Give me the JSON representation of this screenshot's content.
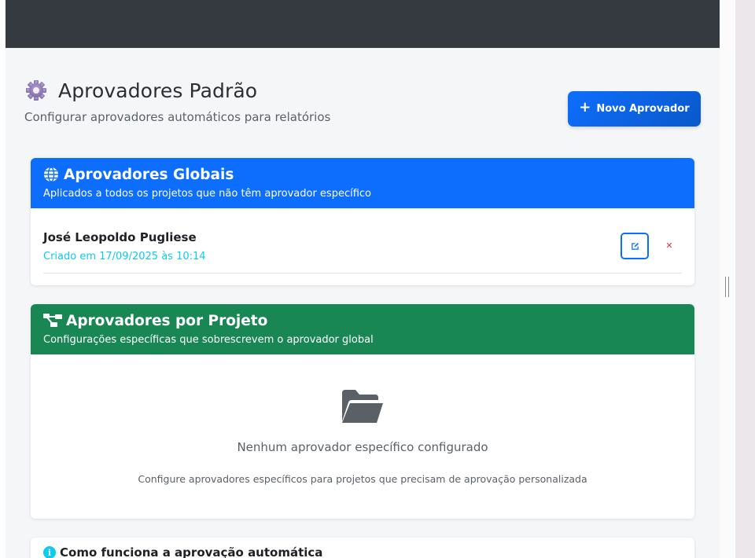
{
  "header": {
    "title": "Aprovadores Padrão",
    "subtitle": "Configurar aprovadores automáticos para relatórios",
    "title_icon": "gear-icon",
    "new_button": {
      "label": "Novo Aprovador",
      "icon": "plus-icon"
    }
  },
  "global_card": {
    "title": "Aprovadores Globais",
    "description": "Aplicados a todos os projetos que não têm aprovador específico",
    "icon": "globe-icon",
    "color": "#0d6efd",
    "approvers": [
      {
        "name": "José Leopoldo Pugliese",
        "created": "Criado em 17/09/2025 às 10:14"
      }
    ]
  },
  "project_card": {
    "title": "Aprovadores por Projeto",
    "description": "Configurações específicas que sobrescrevem o aprovador global",
    "icon": "sitemap-icon",
    "color": "#198754",
    "empty_title": "Nenhum aprovador específico configurado",
    "empty_description": "Configure aprovadores específicos para projetos que precisam de aprovação personalizada",
    "empty_icon": "folder-open-icon"
  },
  "info_card": {
    "title": "Como funciona a aprovação automática",
    "icon": "info-icon"
  }
}
